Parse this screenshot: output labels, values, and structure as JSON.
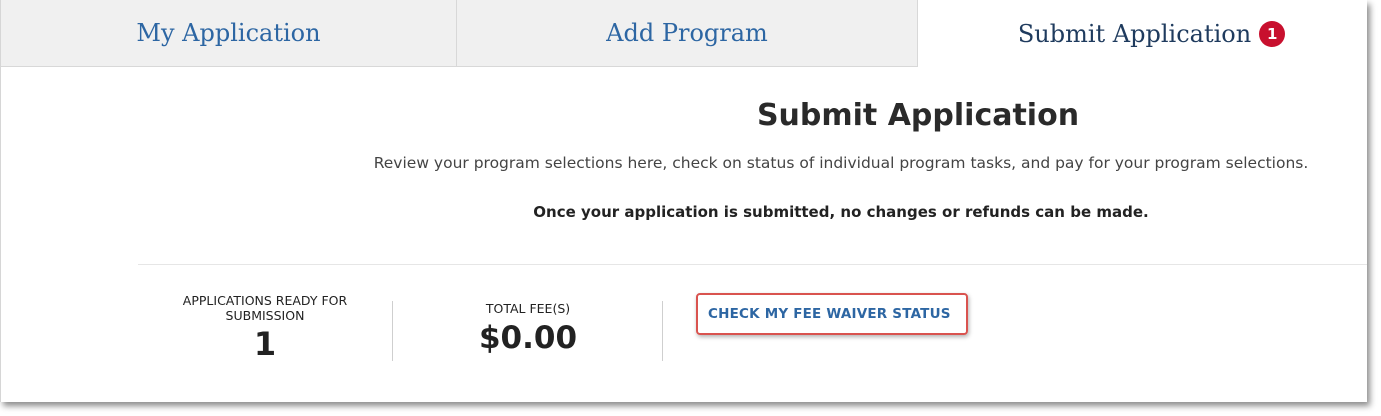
{
  "tabs": [
    {
      "label": "My Application"
    },
    {
      "label": "Add Program"
    },
    {
      "label": "Submit Application",
      "badge": "1"
    }
  ],
  "main": {
    "title": "Submit Application",
    "intro": "Review your program selections here, check on status of individual program tasks, and pay for your program selections.",
    "warning": "Once your application is submitted, no changes or refunds can be made."
  },
  "summary": {
    "ready_label": "APPLICATIONS READY FOR SUBMISSION",
    "ready_value": "1",
    "fee_label": "TOTAL FEE(S)",
    "fee_value": "$0.00",
    "fee_waiver_link": "CHECK MY FEE WAIVER STATUS"
  },
  "colors": {
    "link": "#2d66a3",
    "badge": "#c8102e",
    "highlight_border": "#d9534f"
  }
}
